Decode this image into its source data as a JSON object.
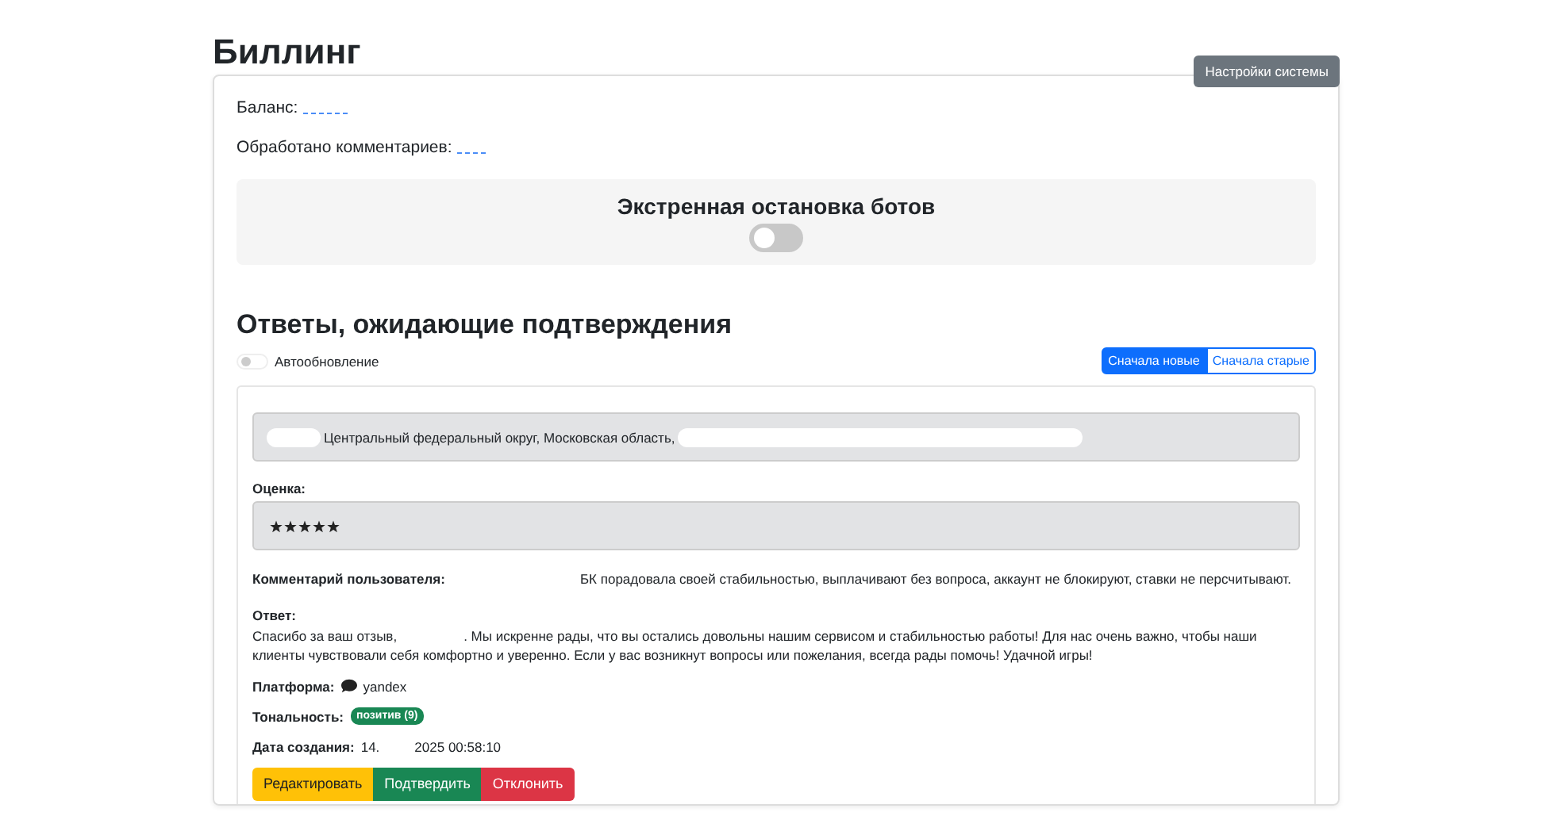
{
  "title": "Биллинг",
  "settings_button": "Настройки системы",
  "balance": {
    "label": "Баланс:"
  },
  "processed": {
    "label": "Обработано комментариев:"
  },
  "emergency_stop": {
    "title": "Экстренная остановка ботов",
    "on": false
  },
  "pending": {
    "title": "Ответы, ожидающие подтверждения",
    "auto_update": {
      "label": "Автообновление",
      "on": false
    },
    "sort_buttons": [
      {
        "label": "Сначала новые",
        "selected": true
      },
      {
        "label": "Сначала старые",
        "selected": false
      }
    ],
    "card": {
      "location": "Центральный федеральный округ, Московская область,",
      "rating_label": "Оценка:",
      "stars": 5,
      "comment_label": "Комментарий пользователя:",
      "comment": "БК порадовала своей стабильностью, выплачивают без вопроса, аккаунт не блокируют, ставки не персчитывают.",
      "answer_label": "Ответ:",
      "answer_start": "Спасибо за ваш отзыв,",
      "answer": ". Мы искренне рады, что вы остались довольны нашим сервисом и стабильностью работы! Для нас очень важно, чтобы наши клиенты чувствовали себя комфортно и уверенно. Если у вас возникнут вопросы или пожелания, всегда рады помочь! Удачной игры!",
      "platform_label": "Платформа:",
      "platform": "yandex",
      "tone_label": "Тональность:",
      "tone": "позитив (9)",
      "date_label": "Дата создания:",
      "date_day": "14.",
      "date_rest": "2025 00:58:10",
      "actions": [
        {
          "label": "Редактировать",
          "kind": "edit"
        },
        {
          "label": "Подтвердить",
          "kind": "confirm"
        },
        {
          "label": "Отклонить",
          "kind": "reject"
        }
      ]
    }
  }
}
